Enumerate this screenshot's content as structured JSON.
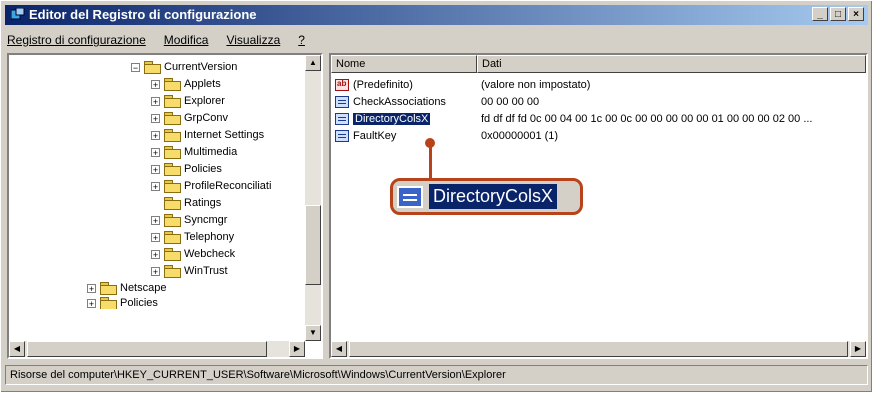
{
  "window": {
    "title": "Editor del Registro di configurazione",
    "buttons": {
      "minimize": "_",
      "maximize": "□",
      "close": "×"
    }
  },
  "menu": [
    "Registro di configurazione",
    "Modifica",
    "Visualizza",
    "?"
  ],
  "tree": {
    "items": [
      {
        "label": "CurrentVersion",
        "expander": "−",
        "level": 0
      },
      {
        "label": "Applets",
        "expander": "+",
        "level": 1
      },
      {
        "label": "Explorer",
        "expander": "+",
        "level": 1
      },
      {
        "label": "GrpConv",
        "expander": "+",
        "level": 1
      },
      {
        "label": "Internet Settings",
        "expander": "+",
        "level": 1
      },
      {
        "label": "Multimedia",
        "expander": "+",
        "level": 1
      },
      {
        "label": "Policies",
        "expander": "+",
        "level": 1
      },
      {
        "label": "ProfileReconciliati",
        "expander": "+",
        "level": 1
      },
      {
        "label": "Ratings",
        "expander": "",
        "level": 1
      },
      {
        "label": "Syncmgr",
        "expander": "+",
        "level": 1
      },
      {
        "label": "Telephony",
        "expander": "+",
        "level": 1
      },
      {
        "label": "Webcheck",
        "expander": "+",
        "level": 1
      },
      {
        "label": "WinTrust",
        "expander": "+",
        "level": 1
      },
      {
        "label": "Netscape",
        "expander": "+",
        "level": -1
      },
      {
        "label": "Policies",
        "expander": "+",
        "level": -1
      }
    ]
  },
  "list": {
    "columns": [
      "Nome",
      "Dati"
    ],
    "rows": [
      {
        "name": "(Predefinito)",
        "data": "(valore non impostato)",
        "icon": "string-value-icon",
        "selected": false
      },
      {
        "name": "CheckAssociations",
        "data": "00 00 00 00",
        "icon": "binary-value-icon",
        "selected": false
      },
      {
        "name": "DirectoryColsX",
        "data": "fd df df fd 0c 00 04 00 1c 00 0c 00 00 00 00 00 01 00 00 00 02 00 ...",
        "icon": "binary-value-icon",
        "selected": true
      },
      {
        "name": "FaultKey",
        "data": "0x00000001 (1)",
        "icon": "dword-value-icon",
        "selected": false
      }
    ]
  },
  "callout": {
    "label": "DirectoryColsX"
  },
  "status": {
    "path": "Risorse del computer\\HKEY_CURRENT_USER\\Software\\Microsoft\\Windows\\CurrentVersion\\Explorer"
  },
  "colors": {
    "title_start": "#0a246a",
    "title_end": "#a6caf0",
    "selection": "#0a246a",
    "callout": "#b8431a",
    "chrome": "#d4d0c8"
  }
}
